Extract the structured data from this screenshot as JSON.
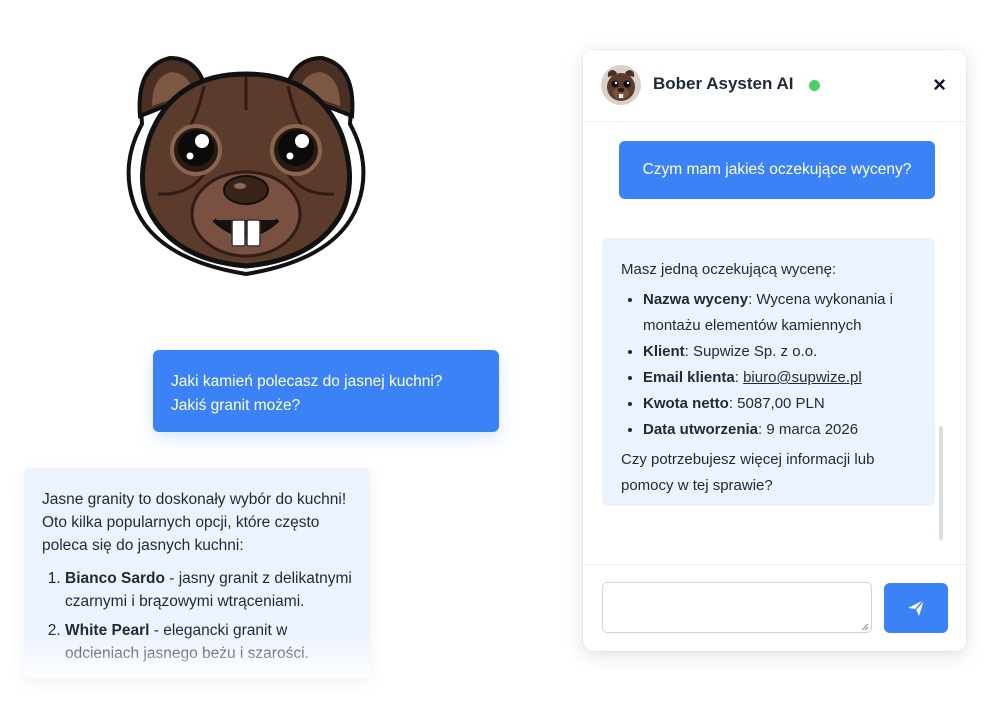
{
  "colors": {
    "accent": "#3b82f6",
    "assistant_bg": "#edf3fd",
    "online": "#4ccf67"
  },
  "mascot": {
    "icon": "beaver-robot-mascot"
  },
  "floating_chat": {
    "user_message": "Jaki kamień polecasz do jasnej kuchni? Jakiś granit może?",
    "assistant_intro": "Jasne granity to doskonały wybór do kuchni! Oto kilka popularnych opcji, które często poleca się do jasnych kuchni:",
    "options": [
      {
        "name": "Bianco Sardo",
        "desc": " - jasny granit z delikatnymi czarnymi i brązowymi wtrąceniami."
      },
      {
        "name": "White Pearl",
        "desc": " - elegancki granit w odcieniach jasnego beżu i szarości."
      }
    ]
  },
  "widget": {
    "title": "Bober Asysten AI",
    "status": "online",
    "close_label": "×",
    "user_message": "Czym mam jakieś oczekujące wyceny?",
    "assistant": {
      "intro": "Masz jedną oczekującą wycenę:",
      "fields": [
        {
          "label": "Nazwa wyceny",
          "value": ": Wycena wykonania i montażu elementów kamiennych"
        },
        {
          "label": "Klient",
          "value": ": Supwize Sp. z o.o."
        },
        {
          "label": "Email klienta",
          "value": ": ",
          "link": "biuro@supwize.pl"
        },
        {
          "label": "Kwota netto",
          "value": ": 5087,00 PLN"
        },
        {
          "label": "Data utworzenia",
          "value": ": 9 marca 2026"
        }
      ],
      "outro": "Czy potrzebujesz więcej informacji lub pomocy w tej sprawie?"
    },
    "input": {
      "value": "",
      "placeholder": ""
    },
    "send_icon": "send-icon"
  }
}
